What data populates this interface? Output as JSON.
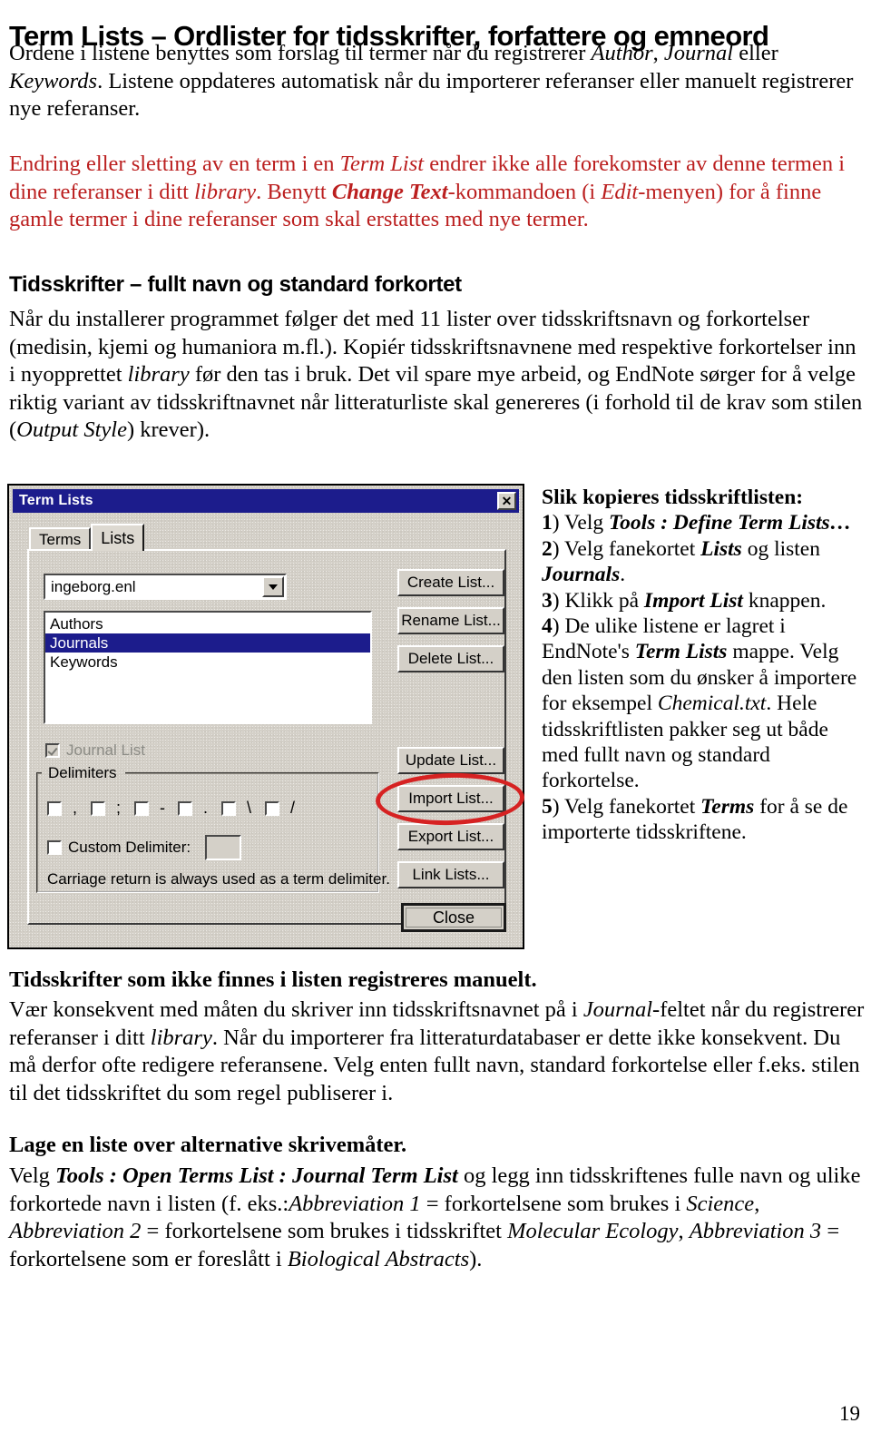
{
  "document": {
    "title": "Term Lists – Ordlister for tidsskrifter, forfattere og emneord",
    "page_number": "19"
  },
  "intro": {
    "html": "Ordene i listene benyttes som forslag til termer når du registrerer <em class=\"it\">Author</em>, <em class=\"it\">Journal</em> eller <em class=\"it\">Keywords</em>. Listene oppdateres automatisk når du importerer referanser eller manuelt registrerer nye referanser."
  },
  "warning": {
    "color": "#bb1f1f",
    "html": "Endring eller sletting av en term i en <em class=\"it\">Term List</em> endrer ikke alle forekomster av denne termen i dine referanser i ditt <em class=\"it\">library</em>. Benytt <b class=\"bi\">Change Text</b>-kommandoen (i <em class=\"it\">Edit</em>-menyen) for å finne gamle termer i dine referanser som skal erstattes med nye termer."
  },
  "section_journals": {
    "heading": "Tidsskrifter – fullt navn og standard forkortet",
    "body_html": "Når du installerer programmet følger det med 11 lister over tidsskriftsnavn og forkortelser (medisin, kjemi og humaniora m.fl.). Kopiér tidsskriftsnavnene med respektive forkortelser inn i nyopprettet <em class=\"it\">library</em> før den tas i bruk. Det vil spare mye arbeid, og EndNote sørger for å velge riktig variant av tidsskriftnavnet når litteraturliste skal genereres (i forhold til de krav som stilen (<em class=\"it\">Output Style</em>) krever)."
  },
  "instructions": {
    "heading": "Slik kopieres tidsskriftlisten:",
    "steps_html": "<b class=\"bd\">1</b>) Velg <b class=\"bi\">Tools : Define Term Lists…</b><br><b class=\"bd\">2</b>) Velg fanekortet <b class=\"bi\">Lists</b> og listen <b class=\"bi\">Journals</b>.<br><b class=\"bd\">3</b>) Klikk på <b class=\"bi\">Import List</b> knappen.<br><b class=\"bd\">4</b>) De ulike listene er lagret i EndNote's <b class=\"bi\">Term Lists</b> mappe. Velg den listen som du ønsker å importere for eksempel <em class=\"it\">Chemical.txt</em>. Hele tidsskriftlisten pakker seg ut både med fullt navn og standard forkortelse.<br><b class=\"bd\">5</b>) Velg fanekortet <b class=\"bi\">Terms</b> for å se de importerte tidsskriftene."
  },
  "dialog": {
    "title": "Term Lists",
    "close_icon_label": "✕",
    "tabs": [
      {
        "label": "Terms",
        "active": false
      },
      {
        "label": "Lists",
        "active": true
      }
    ],
    "library_combo": {
      "value": "ingeborg.enl",
      "arrow_icon": "chevron-down-icon"
    },
    "lists": [
      {
        "label": "Authors",
        "selected": false
      },
      {
        "label": "Journals",
        "selected": true
      },
      {
        "label": "Keywords",
        "selected": false
      }
    ],
    "journal_list_checkbox": {
      "label": "Journal List",
      "checked": true,
      "disabled": true
    },
    "delimiters_group": {
      "legend": "Delimiters",
      "items": [
        {
          "symbol": ",",
          "checked": false
        },
        {
          "symbol": ";",
          "checked": false
        },
        {
          "symbol": "-",
          "checked": false
        },
        {
          "symbol": ".",
          "checked": false
        },
        {
          "symbol": "\\",
          "checked": false
        },
        {
          "symbol": "/",
          "checked": false
        }
      ],
      "custom_delimiter": {
        "label": "Custom Delimiter:",
        "checked": false,
        "value": ""
      },
      "note": "Carriage return is always used as a term delimiter."
    },
    "buttons": {
      "create": "Create List...",
      "rename": "Rename List...",
      "delete": "Delete List...",
      "update": "Update List...",
      "import": "Import List...",
      "export": "Export List...",
      "link": "Link Lists...",
      "close": "Close"
    },
    "annotation": {
      "shape": "red-ellipse",
      "color": "#d62222",
      "targets": "import-list-button"
    }
  },
  "section_manual": {
    "heading": "Tidsskrifter som ikke finnes i listen registreres manuelt.",
    "body_html": "Vær konsekvent med måten du skriver inn tidsskriftsnavnet på i <em class=\"it\">Journal</em>-feltet når du registrerer referanser i ditt <em class=\"it\">library</em>. Når du importerer fra litteraturdatabaser er dette ikke konsekvent. Du må derfor ofte redigere referansene. Velg enten fullt navn, standard forkortelse eller f.eks. stilen til det tidsskriftet du som regel publiserer i."
  },
  "section_alternatives": {
    "heading": "Lage en liste over alternative skrivemåter.",
    "body_html": "Velg <b class=\"bi\">Tools : Open Terms List : Journal Term List</b> og legg inn tidsskriftenes fulle navn og ulike forkortede navn i listen (f. eks.:<em class=\"it\">Abbreviation 1</em> = forkortelsene som brukes i <em class=\"it\">Science</em>, <em class=\"it\">Abbreviation 2</em> = forkortelsene som brukes i tidsskriftet <em class=\"it\">Molecular Ecology</em>, <em class=\"it\">Abbreviation 3</em> = forkortelsene som er foreslått i <em class=\"it\">Biological Abstracts</em>)."
  }
}
